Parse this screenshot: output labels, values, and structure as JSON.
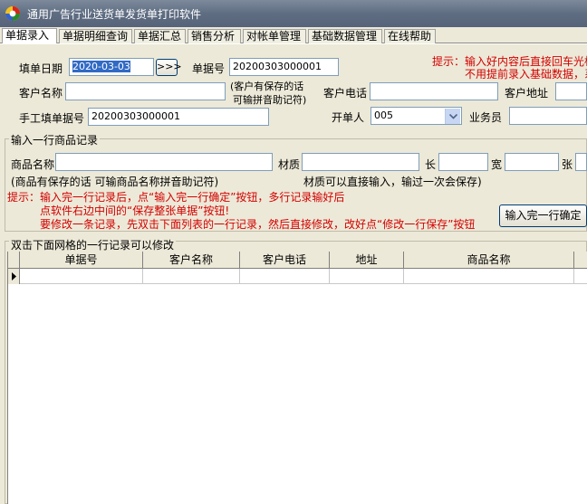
{
  "window": {
    "title": "通用广告行业送货单发货单打印软件"
  },
  "tabs": [
    {
      "label": "单据录入"
    },
    {
      "label": "单据明细查询"
    },
    {
      "label": "单据汇总"
    },
    {
      "label": "销售分析"
    },
    {
      "label": "对帐单管理"
    },
    {
      "label": "基础数据管理"
    },
    {
      "label": "在线帮助"
    }
  ],
  "header": {
    "date_label": "填单日期",
    "date_value": "2020-03-03",
    "date_button": ">>>",
    "order_no_label": "单据号",
    "order_no_value": "20200303000001",
    "tip_line1": "提示：输入好内容后直接回车光标",
    "tip_line2": "不用提前录入基础数据，系",
    "customer_name_label": "客户名称",
    "customer_name_value": "",
    "customer_hint_line1": "(客户有保存的话",
    "customer_hint_line2": "可输拼音助记符)",
    "customer_phone_label": "客户电话",
    "customer_phone_value": "",
    "customer_address_label": "客户地址",
    "customer_address_value": "",
    "manual_no_label": "手工填单据号",
    "manual_no_value": "20200303000001",
    "operator_label": "开单人",
    "operator_value": "005",
    "salesman_label": "业务员",
    "salesman_value": ""
  },
  "item_entry": {
    "legend": "输入一行商品记录",
    "product_name_label": "商品名称",
    "product_name_value": "",
    "material_label": "材质",
    "material_value": "",
    "length_label": "长",
    "length_value": "",
    "width_label": "宽",
    "width_value": "",
    "sheets_label": "张",
    "sheets_value": "",
    "product_hint": "(商品有保存的话  可输商品名称拼音助记符)",
    "material_hint": "材质可以直接输入，输过一次会保存)",
    "tip1": "提示：输入完一行记录后，点“输入完一行确定”按钮，多行记录输好后",
    "tip2": "点软件右边中间的“保存整张单据”按钮!",
    "tip3": "要修改一条记录，先双击下面列表的一行记录，然后直接修改，改好点“修改一行保存”按钮",
    "confirm_button": "输入完一行确定"
  },
  "grid": {
    "legend": "双击下面网格的一行记录可以修改",
    "columns": [
      "单据号",
      "客户名称",
      "客户电话",
      "地址",
      "商品名称",
      ""
    ],
    "rows": [
      [
        "",
        "",
        "",
        "",
        "",
        ""
      ]
    ],
    "row_indicator": "▶"
  },
  "colors": {
    "title_bg": "#5f6d82",
    "panel_bg": "#ece9d8",
    "tip_red": "#d40000",
    "selection_blue": "#316ac5"
  }
}
